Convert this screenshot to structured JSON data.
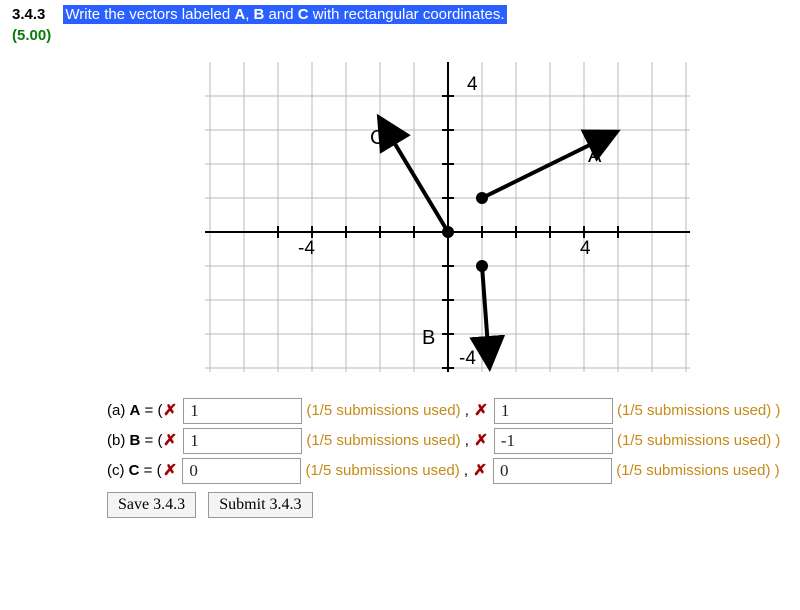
{
  "header": {
    "number": "3.4.3",
    "prompt_prefix": "Write the vectors labeled ",
    "prompt_mid1": ", ",
    "prompt_mid2": " and ",
    "prompt_suffix": " with rectangular coordinates.",
    "v1": "A",
    "v2": "B",
    "v3": "C",
    "points": "(5.00)"
  },
  "graph": {
    "xmin": -7,
    "xmax": 7,
    "ymin": -5,
    "ymax": 5,
    "ticks": {
      "pos": "4",
      "negx": "-4",
      "negy": "-4"
    },
    "labels": {
      "A": "A",
      "B": "B",
      "C": "C"
    }
  },
  "chart_data": {
    "type": "scatter",
    "title": "",
    "xlabel": "",
    "ylabel": "",
    "xlim": [
      -7,
      7
    ],
    "ylim": [
      -5,
      5
    ],
    "vectors": [
      {
        "name": "A",
        "tail": [
          1,
          1
        ],
        "head": [
          5,
          3
        ]
      },
      {
        "name": "B",
        "tail": [
          1,
          -1
        ],
        "head": [
          1.2,
          -4
        ]
      },
      {
        "name": "C",
        "tail": [
          0,
          0
        ],
        "head": [
          -2,
          3.3
        ]
      }
    ]
  },
  "answers": {
    "a": {
      "label_pre": "(a) ",
      "var": "A",
      "open": " = (",
      "val1": "1",
      "sub1": "(1/5 submissions used)",
      "sep": " , ",
      "val2": "1",
      "sub2": "(1/5 submissions used)",
      "close": " )"
    },
    "b": {
      "label_pre": "(b) ",
      "var": "B",
      "open": " = (",
      "val1": "1",
      "sub1": "(1/5 submissions used)",
      "sep": " , ",
      "val2": "-1",
      "sub2": "(1/5 submissions used)",
      "close": " )"
    },
    "c": {
      "label_pre": "(c) ",
      "var": "C",
      "open": " = (",
      "val1": "0",
      "sub1": "(1/5 submissions used)",
      "sep": " , ",
      "val2": "0",
      "sub2": "(1/5 submissions used)",
      "close": " )"
    }
  },
  "buttons": {
    "save": "Save 3.4.3",
    "submit": "Submit 3.4.3"
  },
  "marks": {
    "wrong": "✗"
  }
}
